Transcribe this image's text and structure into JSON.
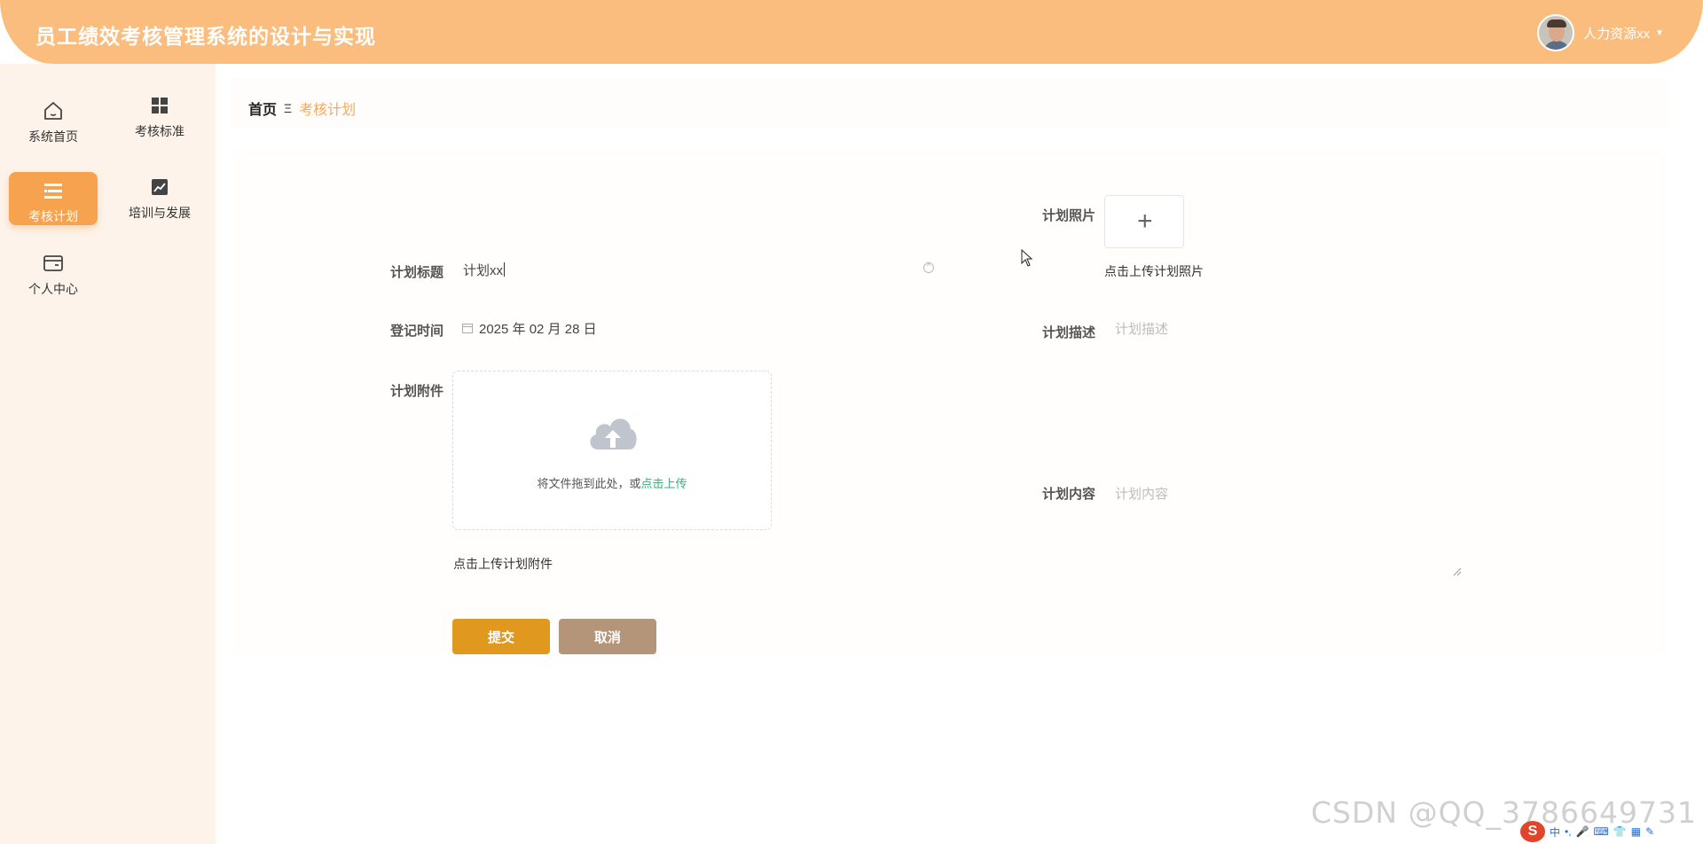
{
  "header": {
    "title": "员工绩效考核管理系统的设计与实现",
    "user_name": "人力资源xx"
  },
  "sidebar": {
    "items": [
      {
        "label": "系统首页",
        "icon": "home-icon",
        "active": false
      },
      {
        "label": "考核标准",
        "icon": "grid-icon",
        "active": false
      },
      {
        "label": "考核计划",
        "icon": "list-icon",
        "active": true
      },
      {
        "label": "培训与发展",
        "icon": "chart-icon",
        "active": false
      },
      {
        "label": "个人中心",
        "icon": "wallet-icon",
        "active": false
      }
    ]
  },
  "breadcrumb": {
    "home": "首页",
    "separator": "Ξ",
    "current": "考核计划"
  },
  "form": {
    "title_label": "计划标题",
    "title_value": "计划xx",
    "date_label": "登记时间",
    "date_value": "2025 年 02 月 28 日",
    "attachment_label": "计划附件",
    "upload_text": "将文件拖到此处，或",
    "upload_link": "点击上传",
    "attachment_hint": "点击上传计划附件",
    "photo_label": "计划照片",
    "photo_hint": "点击上传计划照片",
    "desc_label": "计划描述",
    "desc_placeholder": "计划描述",
    "content_label": "计划内容",
    "content_placeholder": "计划内容",
    "submit": "提交",
    "cancel": "取消"
  },
  "watermark": "CSDN @QQ_3786649731",
  "tray": {
    "ime": "中"
  },
  "colors": {
    "header": "#fbbd7d",
    "active_nav": "#f7a24f",
    "accent_text": "#f6a95b",
    "submit": "#e1981f",
    "cancel": "#b4957a",
    "link": "#3ab07a"
  }
}
